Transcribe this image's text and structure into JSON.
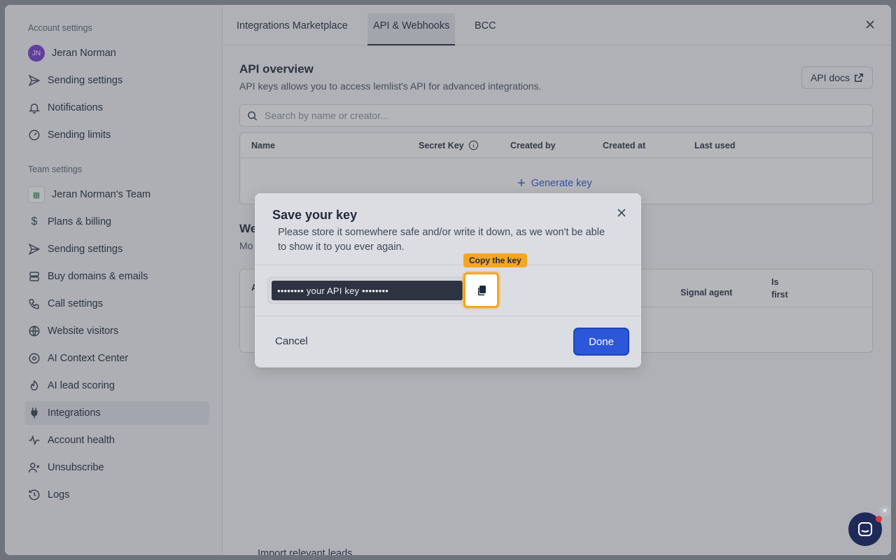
{
  "sidebar": {
    "account_section": "Account settings",
    "team_section": "Team settings",
    "user": {
      "initials": "JN",
      "name": "Jeran Norman"
    },
    "account_items": [
      {
        "label": "Sending settings",
        "icon": "send-icon"
      },
      {
        "label": "Notifications",
        "icon": "bell-icon"
      },
      {
        "label": "Sending limits",
        "icon": "gauge-icon"
      }
    ],
    "team_name": "Jeran Norman's Team",
    "team_items": [
      {
        "label": "Plans & billing",
        "icon": "dollar-icon"
      },
      {
        "label": "Sending settings",
        "icon": "send-icon"
      },
      {
        "label": "Buy domains & emails",
        "icon": "server-icon"
      },
      {
        "label": "Call settings",
        "icon": "phone-icon"
      },
      {
        "label": "Website visitors",
        "icon": "globe-icon"
      },
      {
        "label": "AI Context Center",
        "icon": "ai-icon"
      },
      {
        "label": "AI lead scoring",
        "icon": "flame-icon"
      },
      {
        "label": "Integrations",
        "icon": "plug-icon",
        "active": true
      },
      {
        "label": "Account health",
        "icon": "pulse-icon"
      },
      {
        "label": "Unsubscribe",
        "icon": "user-x-icon"
      },
      {
        "label": "Logs",
        "icon": "history-icon"
      }
    ]
  },
  "tabs": [
    "Integrations Marketplace",
    "API & Webhooks",
    "BCC"
  ],
  "active_tab": "API & Webhooks",
  "api": {
    "title": "API overview",
    "subtitle": "API keys allows you to access lemlist's API for advanced integrations.",
    "docs_label": "API docs",
    "search_placeholder": "Search by name or creator...",
    "columns": [
      "Name",
      "Secret Key",
      "Created by",
      "Created at",
      "Last used"
    ],
    "generate_label": "Generate key"
  },
  "webhooks": {
    "title_fragment": "We",
    "subtitle_fragment": "Mo",
    "col_fragment": "A",
    "columns_visible": [
      "Signal agent",
      "Is first"
    ]
  },
  "bottom_hint": "Import relevant leads",
  "modal": {
    "title": "Save your key",
    "description": "Please store it somewhere safe and/or write it down, as we won't be able to show it to you ever again.",
    "key_masked": "•••••••• your API key ••••••••",
    "tooltip": "Copy the key",
    "cancel_label": "Cancel",
    "done_label": "Done"
  },
  "colors": {
    "accent": "#2b57d8",
    "highlight": "#f5a623",
    "chat": "#1f2a5a"
  }
}
